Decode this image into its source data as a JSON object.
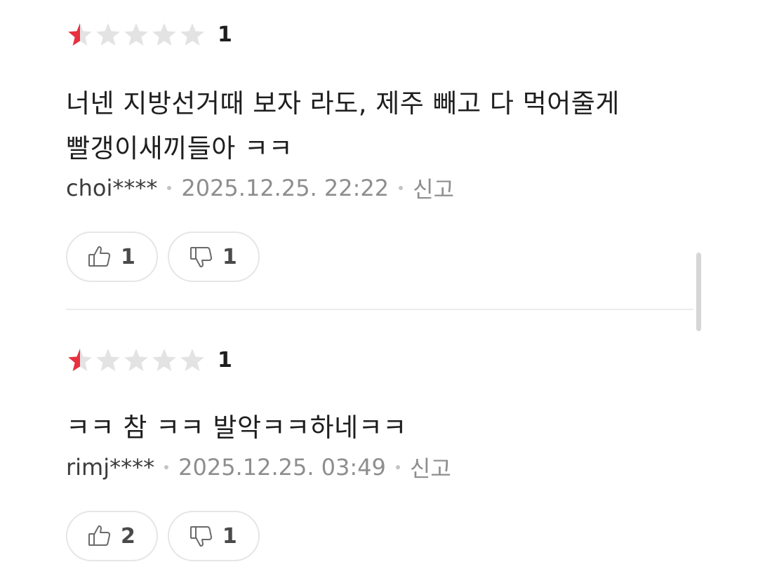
{
  "colors": {
    "star_filled": "#e8303f",
    "star_empty": "#e3e3e3",
    "text": "#1e1e1e",
    "meta": "#8e8e8e"
  },
  "reviews": [
    {
      "rating": 0.5,
      "rating_label": "1",
      "text": "너넨 지방선거때 보자 라도, 제주 빼고 다 먹어줄게 빨갱이새끼들아 ㅋㅋ",
      "author": "choi****",
      "datetime": "2025.12.25. 22:22",
      "report_label": "신고",
      "like_icon": "thumbs-up-icon",
      "like_count": "1",
      "dislike_icon": "thumbs-down-icon",
      "dislike_count": "1"
    },
    {
      "rating": 0.5,
      "rating_label": "1",
      "text": "ㅋㅋ 참 ㅋㅋ 발악ㅋㅋ하네ㅋㅋ",
      "author": "rimj****",
      "datetime": "2025.12.25. 03:49",
      "report_label": "신고",
      "like_icon": "thumbs-up-icon",
      "like_count": "2",
      "dislike_icon": "thumbs-down-icon",
      "dislike_count": "1"
    }
  ]
}
